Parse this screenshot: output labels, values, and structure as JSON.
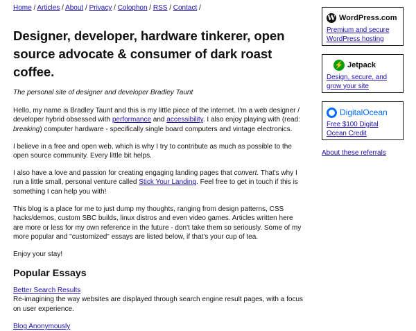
{
  "nav": {
    "items": [
      "Home",
      "Articles",
      "About",
      "Privacy",
      "Colophon",
      "RSS",
      "Contact"
    ],
    "separator": "/"
  },
  "heading": "Designer, developer, hardware tinkerer, open source advocate & consumer of dark roast coffee.",
  "tagline": "The personal site of designer and developer Bradley Taunt",
  "intro": {
    "text_1": "Hello, my name is Bradley Taunt and this is my little piece of the internet. I'm a web designer / developer hybrid obsessed with ",
    "link_performance": "performance",
    "text_2": " and ",
    "link_accessibility": "accessibility",
    "text_3": ". I also enjoy playing with (read: ",
    "text_breaking": "breaking",
    "text_4": ") computer hardware - specifically single board computers and vintage electronics."
  },
  "para_open_web": "I believe in a free and open web, which is why I try to contribute as much as possible to the open source community. Every little bit helps.",
  "para_landing": {
    "text_1": "I also have a love and passion for creating engaging landing pages that ",
    "text_convert": "convert",
    "text_2": ". That's why I run a little small, personal venture called ",
    "link": "Stick Your Landing",
    "text_3": ". Feel free to get in touch if this is something I can help you with!"
  },
  "para_blog": "This blog is a place for me to just dump my thoughts, ranging from design patterns, CSS hacks/demos, custom SBC builds, linux distros and even video games. Articles written here are more or less for my own reference in the future - don't take them so seriously. Some of my more popular and \"customized\" essays are listed below, if that's your cup of tea.",
  "para_enjoy": "Enjoy your stay!",
  "essays": {
    "heading": "Popular Essays",
    "items": [
      {
        "title": "Better Search Results",
        "desc": "Re-imagining the way websites are displayed through search engine result pages, with a focus on user experience."
      },
      {
        "title": "Blog Anonymously",
        "desc": ""
      }
    ]
  },
  "sidebar": {
    "refs": [
      {
        "brand": "WordPress.com",
        "icon": "wordpress-icon",
        "link": "Premium and secure WordPress hosting"
      },
      {
        "brand": "Jetpack",
        "icon": "jetpack-icon",
        "link": "Design, secure, and grow your site"
      },
      {
        "brand": "DigitalOcean",
        "icon": "digitalocean-icon",
        "link": "Free $100 Digital Ocean Credit"
      }
    ],
    "about_link": "About these referrals"
  }
}
